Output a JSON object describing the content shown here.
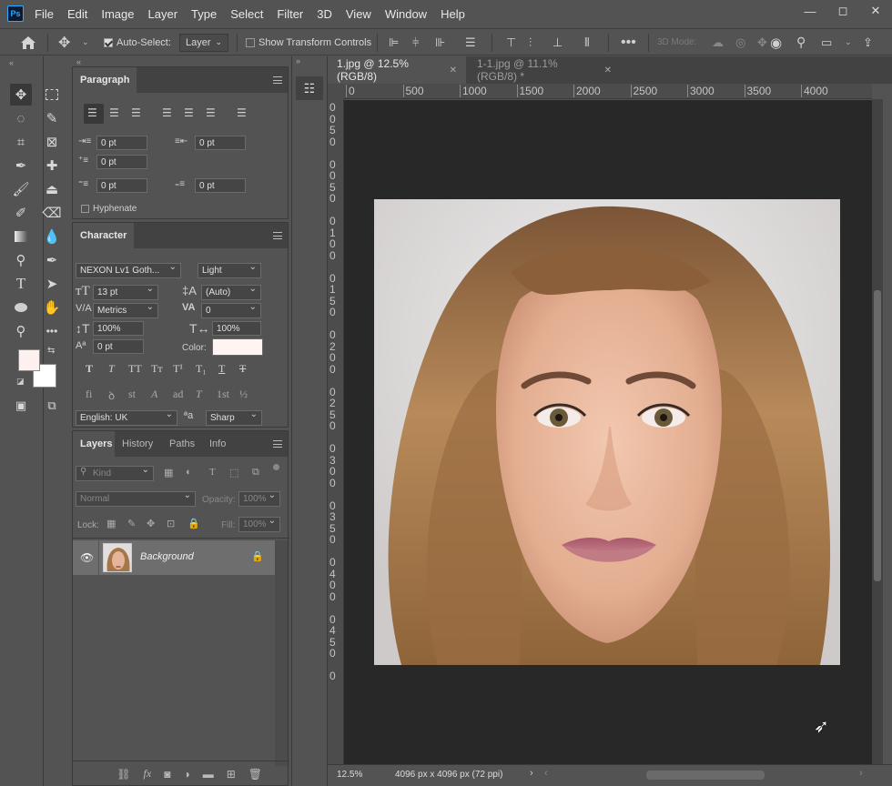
{
  "app": {
    "logo": "Ps"
  },
  "menu": [
    "File",
    "Edit",
    "Image",
    "Layer",
    "Type",
    "Select",
    "Filter",
    "3D",
    "View",
    "Window",
    "Help"
  ],
  "window_controls": {
    "minimize": "—",
    "restore": "◻",
    "close": "✕"
  },
  "options": {
    "auto_select_label": "Auto-Select:",
    "auto_select_value": "Layer",
    "show_transform_label": "Show Transform Controls",
    "mode_3d_label": "3D Mode:"
  },
  "paragraph": {
    "tab": "Paragraph",
    "indent_left": "0 pt",
    "indent_right": "0 pt",
    "indent_first": "0 pt",
    "space_before": "0 pt",
    "space_after": "0 pt",
    "hyphenate_label": "Hyphenate"
  },
  "character": {
    "tab": "Character",
    "font_family": "NEXON Lv1 Goth...",
    "font_style": "Light",
    "font_size": "13 pt",
    "leading": "(Auto)",
    "kerning": "Metrics",
    "tracking": "0",
    "vscale": "100%",
    "hscale": "100%",
    "baseline": "0 pt",
    "color_label": "Color:",
    "color_value": "#fff4f2",
    "style_buttons": [
      "T",
      "T",
      "TT",
      "Tт",
      "T¹",
      "T₁",
      "T",
      "T"
    ],
    "opentype_buttons": [
      "fi",
      "ꝺ",
      "st",
      "A",
      "ad",
      "T",
      "1st",
      "½"
    ],
    "language": "English: UK",
    "aa_icon": "ªa",
    "antialias": "Sharp"
  },
  "layers": {
    "tabs": [
      "Layers",
      "History",
      "Paths",
      "Info"
    ],
    "filter_kind": "Kind",
    "blend_mode": "Normal",
    "opacity_label": "Opacity:",
    "opacity": "100%",
    "lock_label": "Lock:",
    "fill_label": "Fill:",
    "fill": "100%",
    "items": [
      {
        "name": "Background",
        "visible": true,
        "locked": true
      }
    ]
  },
  "documents": {
    "tabs": [
      {
        "label": "1.jpg @ 12.5% (RGB/8)",
        "active": true
      },
      {
        "label": "1-1.jpg @ 11.1% (RGB/8) *",
        "active": false
      }
    ],
    "h_ruler": [
      "0",
      "500",
      "1000",
      "1500",
      "2000",
      "2500",
      "3000",
      "3500",
      "4000"
    ],
    "v_ruler": [
      "0",
      "0",
      "5",
      "0",
      "0",
      "0",
      "5",
      "0",
      "0",
      "1",
      "0",
      "0",
      "0",
      "1",
      "5",
      "0",
      "0",
      "2",
      "0",
      "0",
      "0",
      "2",
      "5",
      "0",
      "0",
      "3",
      "0",
      "0",
      "0",
      "3",
      "5",
      "0",
      "0",
      "4",
      "0",
      "0",
      "0",
      "4",
      "5",
      "0",
      "0"
    ]
  },
  "status": {
    "zoom": "12.5%",
    "doc_info": "4096 px x 4096 px (72 ppi)"
  },
  "colors": {
    "foreground": "#fdf1ef",
    "background": "#ffffff",
    "accent": "#31a8ff"
  }
}
